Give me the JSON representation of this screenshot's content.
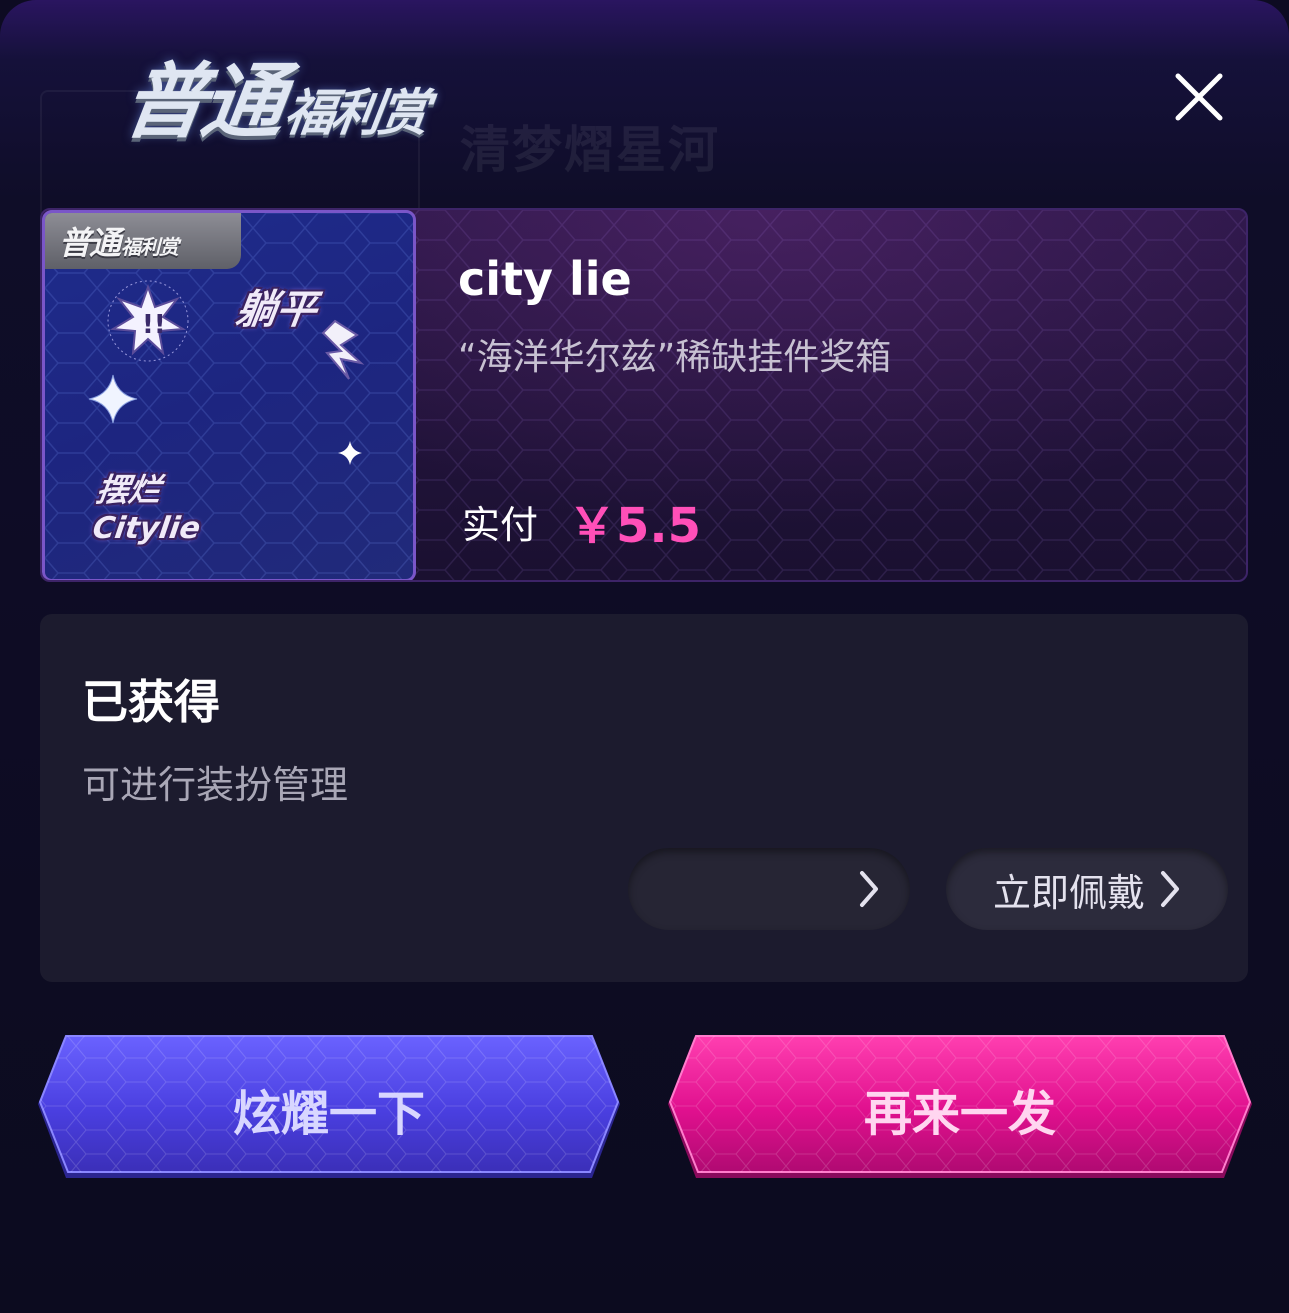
{
  "header": {
    "title_big": "普通",
    "title_small": "福利赏",
    "ghost_text": "清梦熠星河"
  },
  "prize": {
    "tag_big": "普通",
    "tag_small": "福利赏",
    "sticker_top": "躺平",
    "sticker_bottom_1": "摆烂",
    "sticker_bottom_2": "Citylie",
    "name": "city lie",
    "description": "“海洋华尔兹”稀缺挂件奖箱",
    "paid_label": "实付",
    "paid_price": "￥5.5"
  },
  "obtained": {
    "title": "已获得",
    "subtitle": "可进行装扮管理",
    "button_left": "",
    "button_right": "立即佩戴"
  },
  "actions": {
    "show_off": "炫耀一下",
    "again": "再来一发"
  },
  "colors": {
    "price": "#ff4fb8",
    "show_off_button": "#4a3fe0",
    "again_button": "#e0108e"
  }
}
